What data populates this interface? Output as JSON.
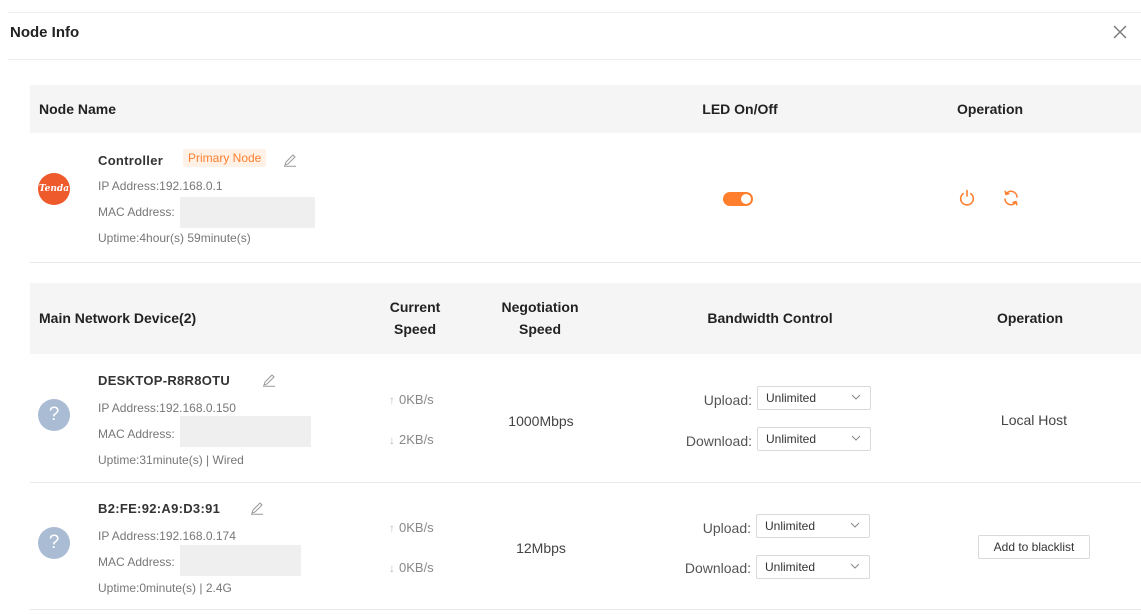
{
  "dialog": {
    "title": "Node Info",
    "close_icon": "close-icon"
  },
  "node_table": {
    "headers": {
      "name": "Node Name",
      "led": "LED On/Off",
      "operation": "Operation"
    },
    "node": {
      "name": "Controller",
      "badge": "Primary Node",
      "logo_text": "Tenda",
      "ip": "IP Address:192.168.0.1",
      "mac": "MAC Address:",
      "uptime": "Uptime:4hour(s) 59minute(s)",
      "led_on": true,
      "accent_color": "#ff7f2f",
      "operation_icons": [
        "power-icon",
        "reboot-icon"
      ]
    }
  },
  "device_table": {
    "headers": {
      "device": "Main Network Device(2)",
      "current_speed_1": "Current",
      "current_speed_2": "Speed",
      "negotiation_1": "Negotiation",
      "negotiation_2": "Speed",
      "bandwidth": "Bandwidth Control",
      "operation": "Operation"
    },
    "rows": [
      {
        "name": "DESKTOP-R8R8OTU",
        "ip": "IP Address:192.168.0.150",
        "mac": "MAC Address:",
        "uptime": "Uptime:31minute(s) | Wired",
        "up_speed": "0KB/s",
        "down_speed": "2KB/s",
        "negotiation": "1000Mbps",
        "upload_label": "Upload:",
        "upload_value": "Unlimited",
        "download_label": "Download:",
        "download_value": "Unlimited",
        "operation": "Local Host"
      },
      {
        "name": "B2:FE:92:A9:D3:91",
        "ip": "IP Address:192.168.0.174",
        "mac": "MAC Address:",
        "uptime": "Uptime:0minute(s) | 2.4G",
        "up_speed": "0KB/s",
        "down_speed": "0KB/s",
        "negotiation": "12Mbps",
        "upload_label": "Upload:",
        "upload_value": "Unlimited",
        "download_label": "Download:",
        "download_value": "Unlimited",
        "operation": "Add to blacklist"
      }
    ]
  }
}
